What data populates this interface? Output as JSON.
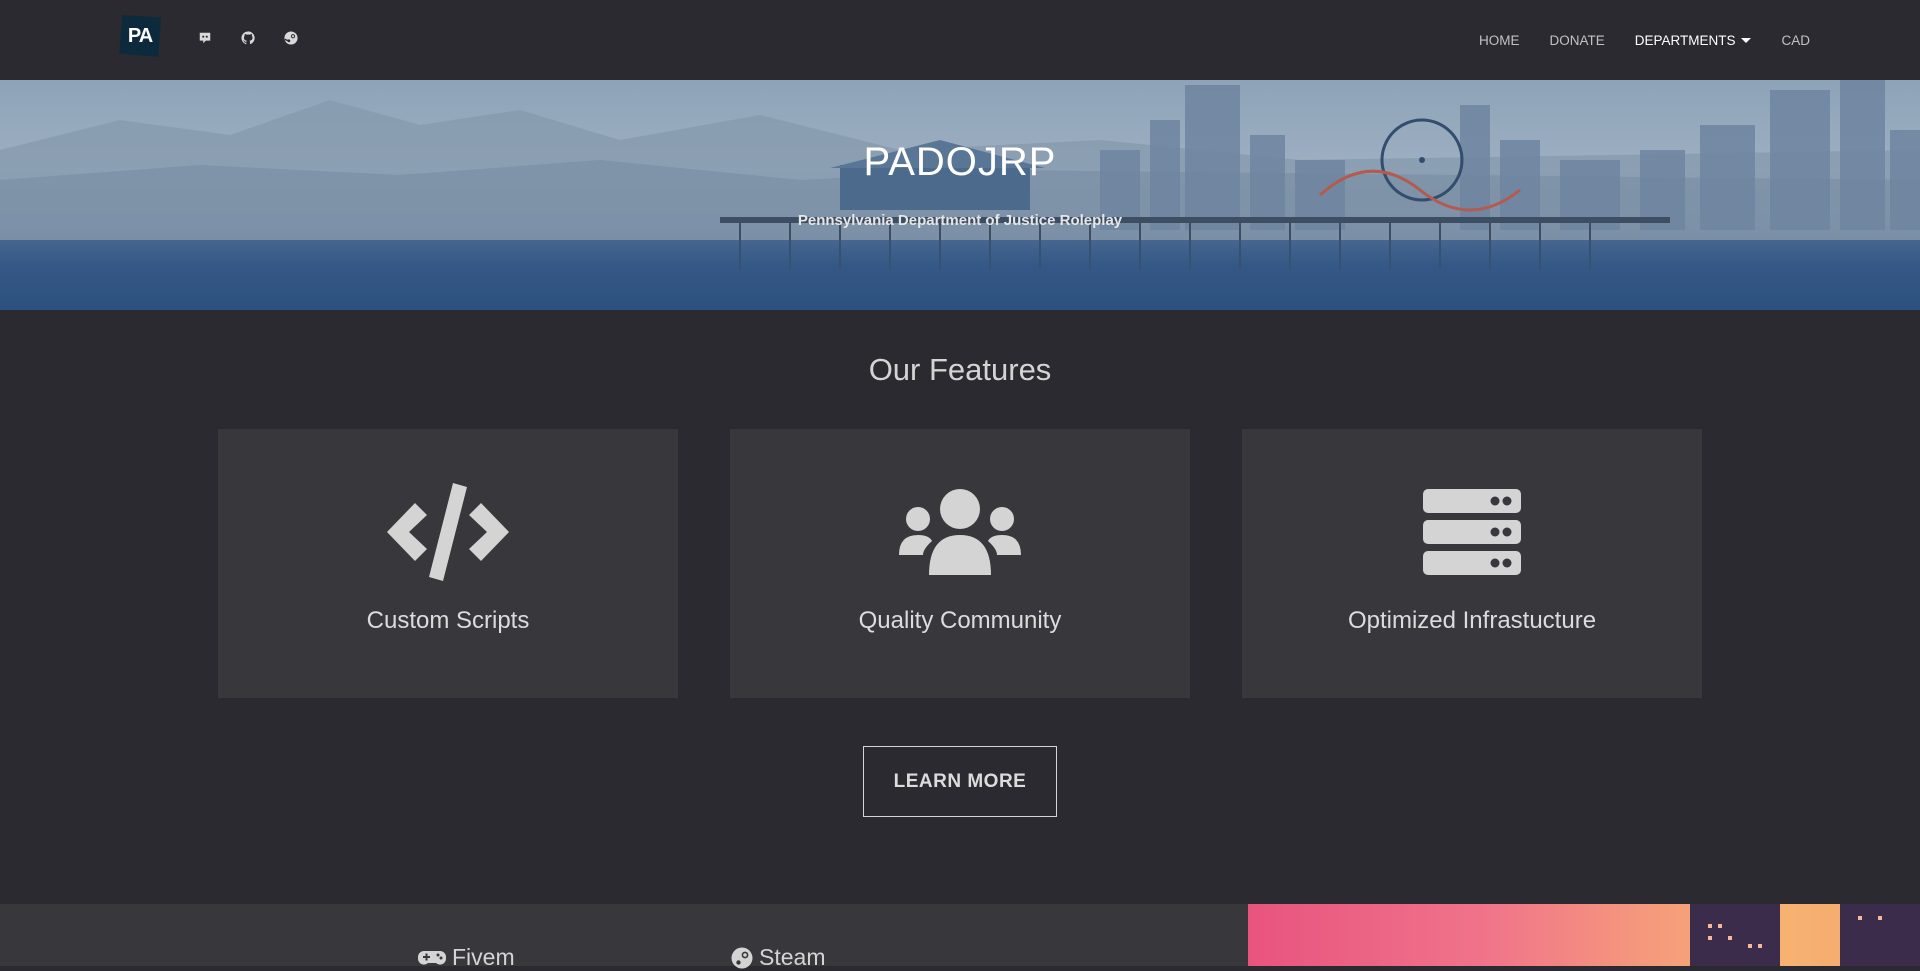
{
  "brand": {
    "logo_text": "PA"
  },
  "nav": {
    "social_icons": [
      "discord-icon",
      "github-icon",
      "steam-icon"
    ],
    "links": [
      {
        "label": "HOME"
      },
      {
        "label": "DONATE"
      },
      {
        "label": "DEPARTMENTS"
      },
      {
        "label": "CAD"
      }
    ]
  },
  "hero": {
    "title": "PADOJRP",
    "subtitle": "Pennsylvania Department of Justice Roleplay"
  },
  "features": {
    "heading": "Our Features",
    "items": [
      {
        "icon": "code-icon",
        "label": "Custom Scripts"
      },
      {
        "icon": "users-icon",
        "label": "Quality Community"
      },
      {
        "icon": "server-icon",
        "label": "Optimized Infrastucture"
      }
    ],
    "button_label": "LEARN MORE"
  },
  "bottom": {
    "items": [
      {
        "icon": "gamepad-icon",
        "label": "Fivem"
      },
      {
        "icon": "steam-icon",
        "label": "Steam"
      }
    ]
  },
  "colors": {
    "background": "#2b2a30",
    "card": "#38373c",
    "text": "#d4d4d4"
  }
}
